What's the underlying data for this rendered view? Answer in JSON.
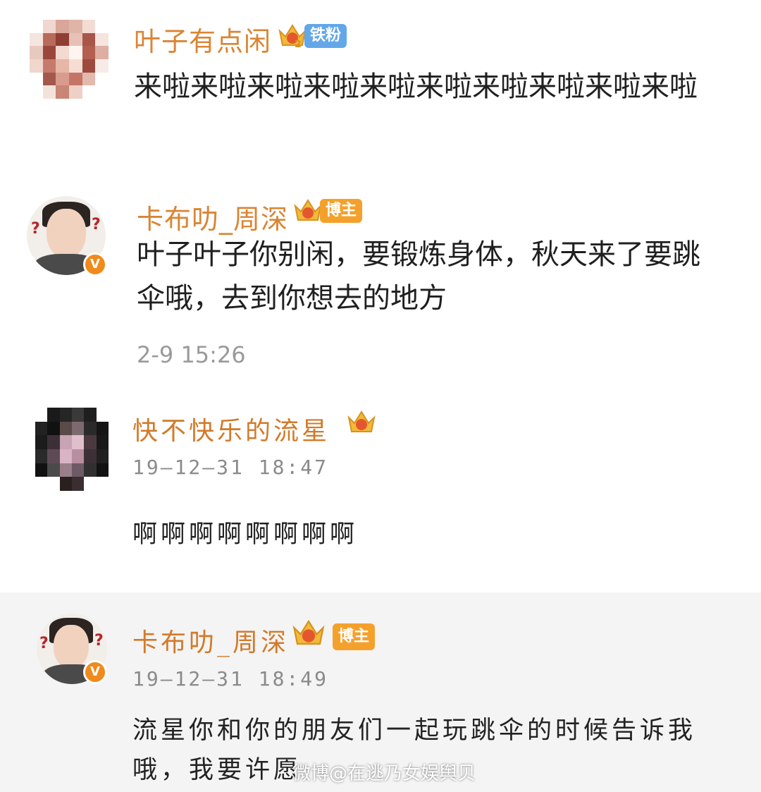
{
  "comments": [
    {
      "username": "叶子有点闲",
      "tag": "铁粉",
      "tag_color": "#62a7e8",
      "crown_level": "2",
      "text": "来啦来啦来啦来啦来啦来啦来啦来啦来啦来啦",
      "avatar": "pixelated-avatar"
    },
    {
      "username": "卡布叻_周深",
      "tag": "博主",
      "tag_color": "#f4a12c",
      "verified": "V",
      "text": "叶子叶子你别闲，要锻炼身体，秋天来了要跳伞哦，去到你想去的地方",
      "time": "2-9 15:26",
      "avatar": "blogger-avatar"
    },
    {
      "username": "快不快乐的流星",
      "time": "19—12—31  18:47",
      "text": "啊啊啊啊啊啊啊啊",
      "avatar": "pixelated-avatar"
    },
    {
      "username": "卡布叻_周深",
      "tag": "博主",
      "tag_color": "#f4a12c",
      "verified": "V",
      "time": "19—12—31  18:49",
      "text": "流星你和你的朋友们一起玩跳伞的时候告诉我哦，我要许愿",
      "avatar": "blogger-avatar"
    }
  ],
  "watermark": "微博@在逃乃女娱舆贝",
  "colors": {
    "username": "#d98534",
    "crown": "#f2b93b",
    "timestamp": "#9a9a9a"
  }
}
